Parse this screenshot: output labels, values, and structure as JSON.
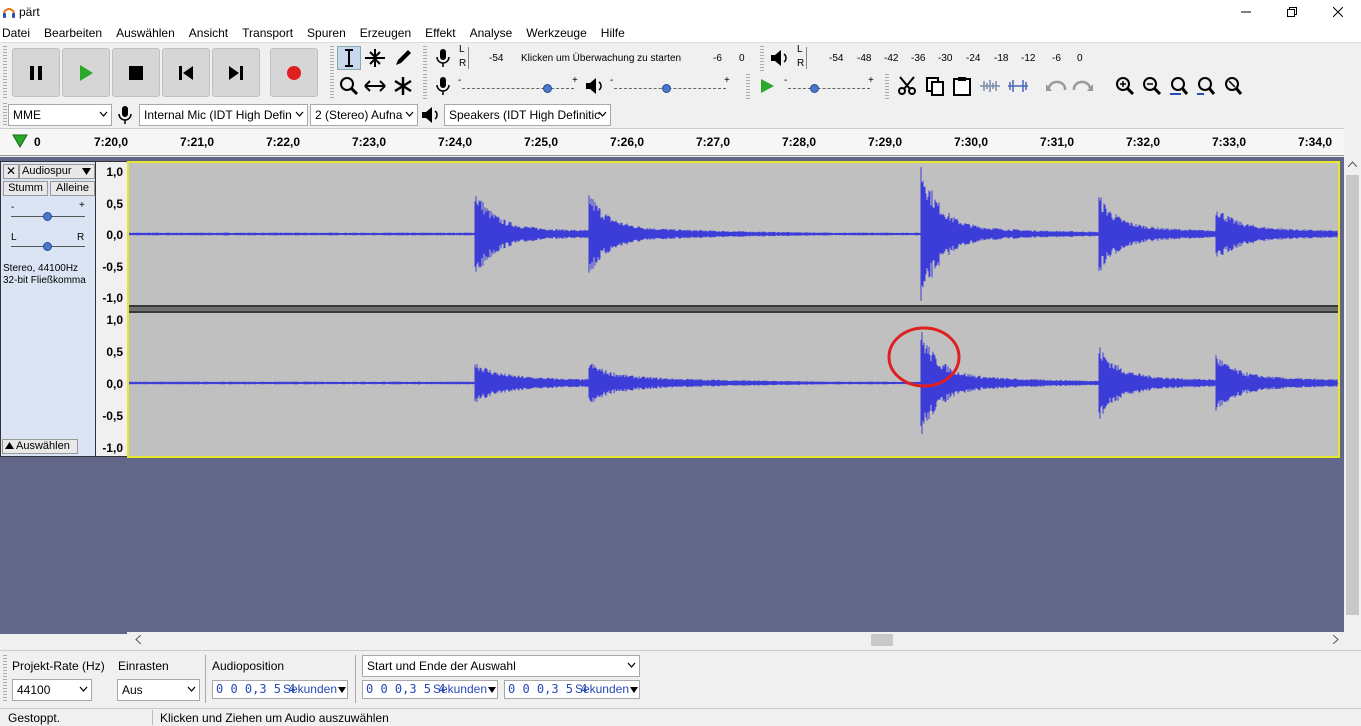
{
  "window": {
    "title": "pärt"
  },
  "menu": [
    "Datei",
    "Bearbeiten",
    "Auswählen",
    "Ansicht",
    "Transport",
    "Spuren",
    "Erzeugen",
    "Effekt",
    "Analyse",
    "Werkzeuge",
    "Hilfe"
  ],
  "meter": {
    "record_lr": [
      "L",
      "R"
    ],
    "record_ticks": [
      "-54",
      "-6",
      "0"
    ],
    "record_hint": "Klicken um Überwachung zu starten",
    "play_lr": [
      "L",
      "R"
    ],
    "play_ticks": [
      "-54",
      "-48",
      "-42",
      "-36",
      "-30",
      "-24",
      "-18",
      "-12",
      "-6",
      "0"
    ]
  },
  "devices": {
    "host": "MME",
    "input": "Internal Mic (IDT High Defin",
    "channels": "2 (Stereo) Aufna",
    "output": "Speakers (IDT High Definitic"
  },
  "ruler": {
    "start": "0",
    "labels": [
      "7:20,0",
      "7:21,0",
      "7:22,0",
      "7:23,0",
      "7:24,0",
      "7:25,0",
      "7:26,0",
      "7:27,0",
      "7:28,0",
      "7:29,0",
      "7:30,0",
      "7:31,0",
      "7:32,0",
      "7:33,0",
      "7:34,0"
    ]
  },
  "track": {
    "name": "Audiospur",
    "mute": "Stumm",
    "solo": "Alleine",
    "gain_minus": "-",
    "gain_plus": "+",
    "pan_left": "L",
    "pan_right": "R",
    "info_line1": "Stereo, 44100Hz",
    "info_line2": "32-bit Fließkomma",
    "select": "Auswählen",
    "vruler_labels": [
      "1,0",
      "0,5",
      "0,0",
      "-0,5",
      "-1,0"
    ]
  },
  "colors": {
    "waveform": "#3c3cd8",
    "highlight_circle": "#e02020",
    "track_border": "#e6e62d"
  },
  "selection": {
    "rate_label": "Projekt-Rate (Hz)",
    "rate_value": "44100",
    "snap_label": "Einrasten",
    "snap_value": "Aus",
    "audio_pos_label": "Audioposition",
    "sel_mode": "Start und Ende der Auswahl",
    "audio_pos": "0 0 0,3 5 4",
    "sel_start": "0 0 0,3 5 4",
    "sel_end": "0 0 0,3 5 4",
    "unit": "Sekunden"
  },
  "status": {
    "state": "Gestoppt.",
    "hint": "Klicken und Ziehen um Audio auszuwählen"
  }
}
